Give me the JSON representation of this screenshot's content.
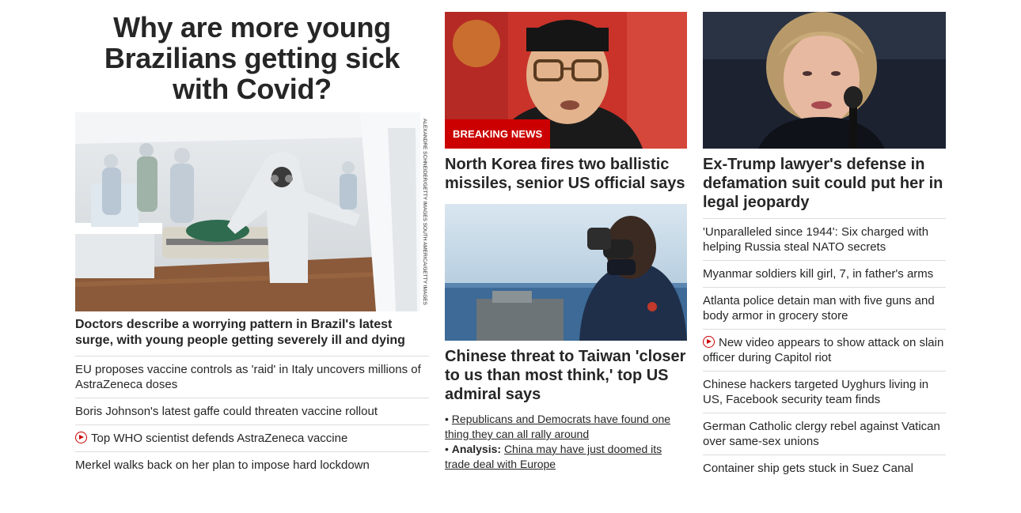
{
  "left": {
    "hero_title": "Why are more young Brazilians getting sick with Covid?",
    "photo_credit": "ALEXANDRE SCHNEIDER/GETTY IMAGES SOUTH AMERICA/GETTY IMAGES",
    "lead_headline": "Doctors describe a worrying pattern in Brazil's latest surge, with young people getting severely ill and dying",
    "stories": [
      "EU proposes vaccine controls as 'raid' in Italy uncovers millions of AstraZeneca doses",
      "Boris Johnson's latest gaffe could threaten vaccine rollout",
      "Top WHO scientist defends AstraZeneca vaccine",
      "Merkel walks back on her plan to impose hard lockdown"
    ]
  },
  "middle": {
    "breaking_label": "BREAKING NEWS",
    "headline1": "North Korea fires two ballistic missiles, senior US official says",
    "headline2": "Chinese threat to Taiwan 'closer to us than most think,' top US admiral says",
    "related1": "Republicans and Democrats have found one thing they can all rally around",
    "related2_prefix": "Analysis:",
    "related2": "China may have just doomed its trade deal with Europe"
  },
  "right": {
    "headline": "Ex-Trump lawyer's defense in defamation suit could put her in legal jeopardy",
    "stories": [
      "'Unparalleled since 1944': Six charged with helping Russia steal NATO secrets",
      "Myanmar soldiers kill girl, 7, in father's arms",
      "Atlanta police detain man with five guns and body armor in grocery store",
      "New video appears to show attack on slain officer during Capitol riot",
      "Chinese hackers targeted Uyghurs living in US, Facebook security team finds",
      "German Catholic clergy rebel against Vatican over same-sex unions",
      "Container ship gets stuck in Suez Canal"
    ]
  },
  "colors": {
    "accent": "#cc0000",
    "text": "#262626",
    "divider": "#dcdcdc"
  }
}
